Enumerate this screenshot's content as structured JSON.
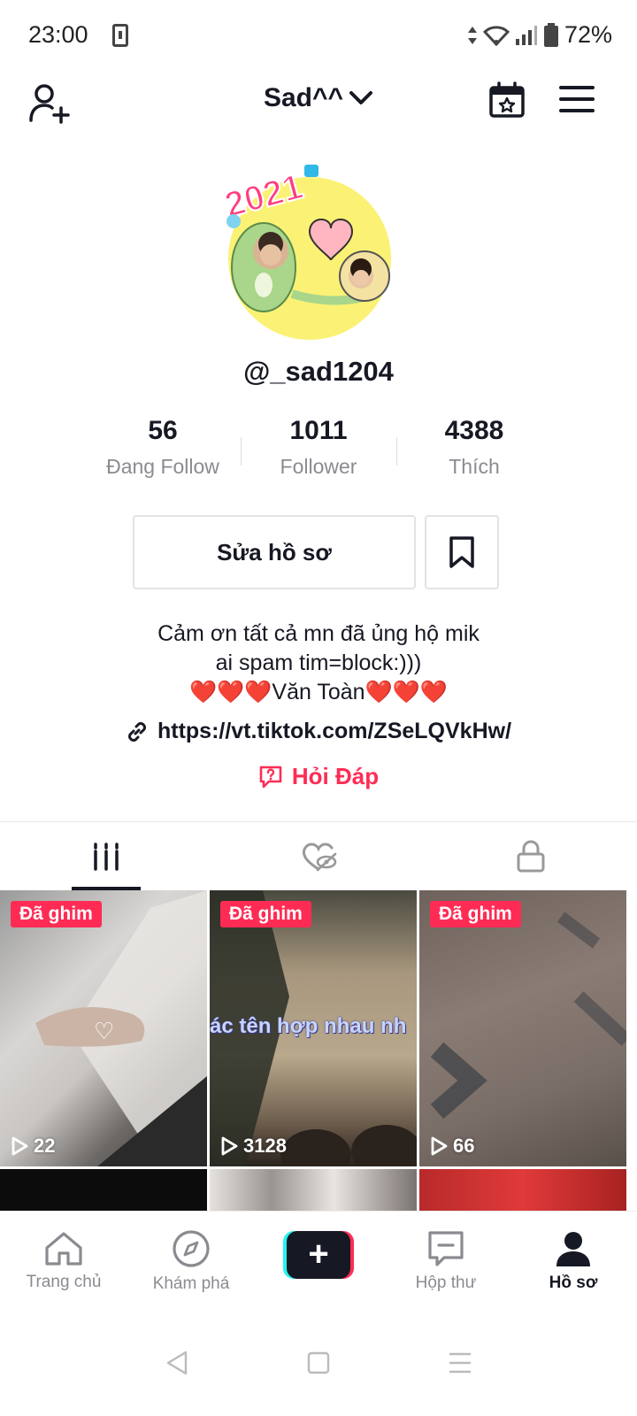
{
  "status_bar": {
    "time": "23:00",
    "battery": "72%"
  },
  "header": {
    "username": "Sad^^"
  },
  "profile": {
    "handle": "@_sad1204",
    "avatar_text": "2021",
    "stats": [
      {
        "value": "56",
        "label": "Đang Follow"
      },
      {
        "value": "1011",
        "label": "Follower"
      },
      {
        "value": "4388",
        "label": "Thích"
      }
    ],
    "edit_label": "Sửa hồ sơ",
    "bio_line1": "Cảm ơn tất cả mn đã ủng hộ mik",
    "bio_line2": "ai spam tim=block:)))",
    "bio_line3": "❤️❤️❤️Văn Toàn❤️❤️❤️",
    "link": "https://vt.tiktok.com/ZSeLQVkHw/",
    "qa_label": "Hỏi Đáp"
  },
  "videos": [
    {
      "pinned": "Đã ghim",
      "views": "22",
      "overlay": "♡"
    },
    {
      "pinned": "Đã ghim",
      "views": "3128",
      "overlay": "ác tên hợp nhau nh"
    },
    {
      "pinned": "Đã ghim",
      "views": "66",
      "overlay": ""
    }
  ],
  "bottom_nav": {
    "home": "Trang chủ",
    "discover": "Khám phá",
    "inbox": "Hộp thư",
    "profile": "Hồ sơ"
  },
  "colors": {
    "accent": "#fe2c55",
    "cyan": "#25f4ee",
    "text": "#161823",
    "muted": "#8a8b91"
  }
}
